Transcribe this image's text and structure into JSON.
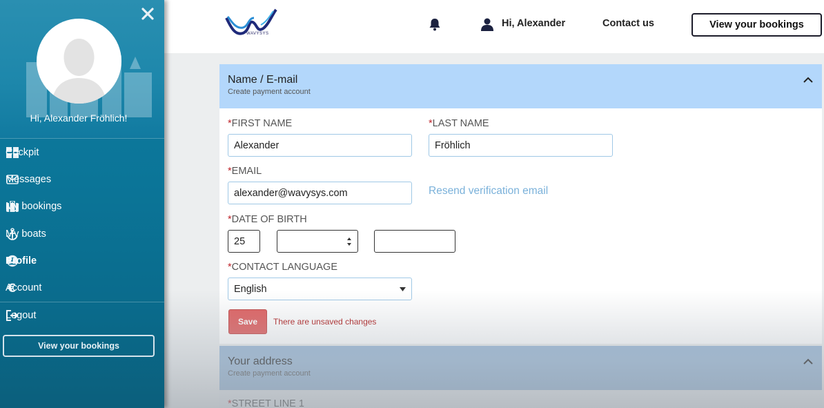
{
  "sidebar": {
    "greeting": "Hi, Alexander Fröhlich!",
    "items": [
      {
        "label": "Cockpit",
        "icon": "grid-icon"
      },
      {
        "label": "Messages",
        "icon": "envelope-icon"
      },
      {
        "label": "My bookings",
        "icon": "briefcase-icon"
      },
      {
        "label": "My boats",
        "icon": "anchor-icon"
      },
      {
        "label": "Profile",
        "icon": "user-circle-icon",
        "active": true
      },
      {
        "label": "Account",
        "icon": "euro-icon"
      },
      {
        "label": "Logout",
        "icon": "logout-icon"
      }
    ],
    "bookings_button": "View your bookings"
  },
  "header": {
    "logo_text": "WAVYSYS",
    "greeting": "Hi, Alexander",
    "contact": "Contact us",
    "bookings_button": "View your bookings"
  },
  "section_name": {
    "title": "Name / E-mail",
    "subtitle": "Create payment account",
    "first_name_label": "FIRST NAME",
    "first_name_value": "Alexander",
    "last_name_label": "LAST NAME",
    "last_name_value": "Fröhlich",
    "email_label": "EMAIL",
    "email_value": "alexander@wavysys.com",
    "resend_link": "Resend verification email",
    "dob_label": "DATE OF BIRTH",
    "dob_day": "25",
    "dob_month": "",
    "dob_year": "",
    "language_label": "CONTACT LANGUAGE",
    "language_value": "English",
    "save_label": "Save",
    "unsaved_text": "There are unsaved changes",
    "required_mark": "*"
  },
  "section_address": {
    "title": "Your address",
    "subtitle": "Create payment account",
    "street_label": "STREET LINE 1"
  },
  "colors": {
    "sidebar": "#0b7598",
    "panel_header": "#b3d7fb",
    "save_button": "#e05f5f",
    "required": "#c0272d",
    "link": "#7ab1da"
  }
}
